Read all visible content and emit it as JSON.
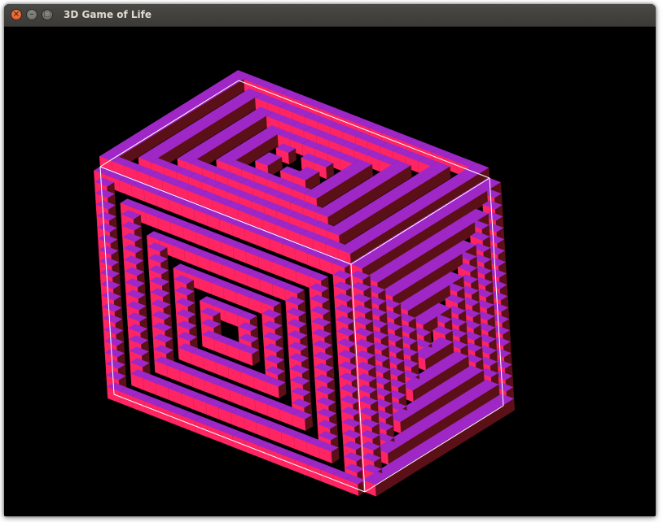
{
  "window": {
    "title": "3D Game of Life",
    "buttons": {
      "close_icon": "close-icon",
      "minimize_icon": "minimize-icon",
      "maximize_icon": "maximize-icon"
    }
  },
  "viewport": {
    "background": "#000000",
    "bounding_box_color": "#ffffff",
    "cell_colors": {
      "top": "#9e27c8",
      "left": "#ff2462",
      "right": "#5a1016"
    }
  }
}
